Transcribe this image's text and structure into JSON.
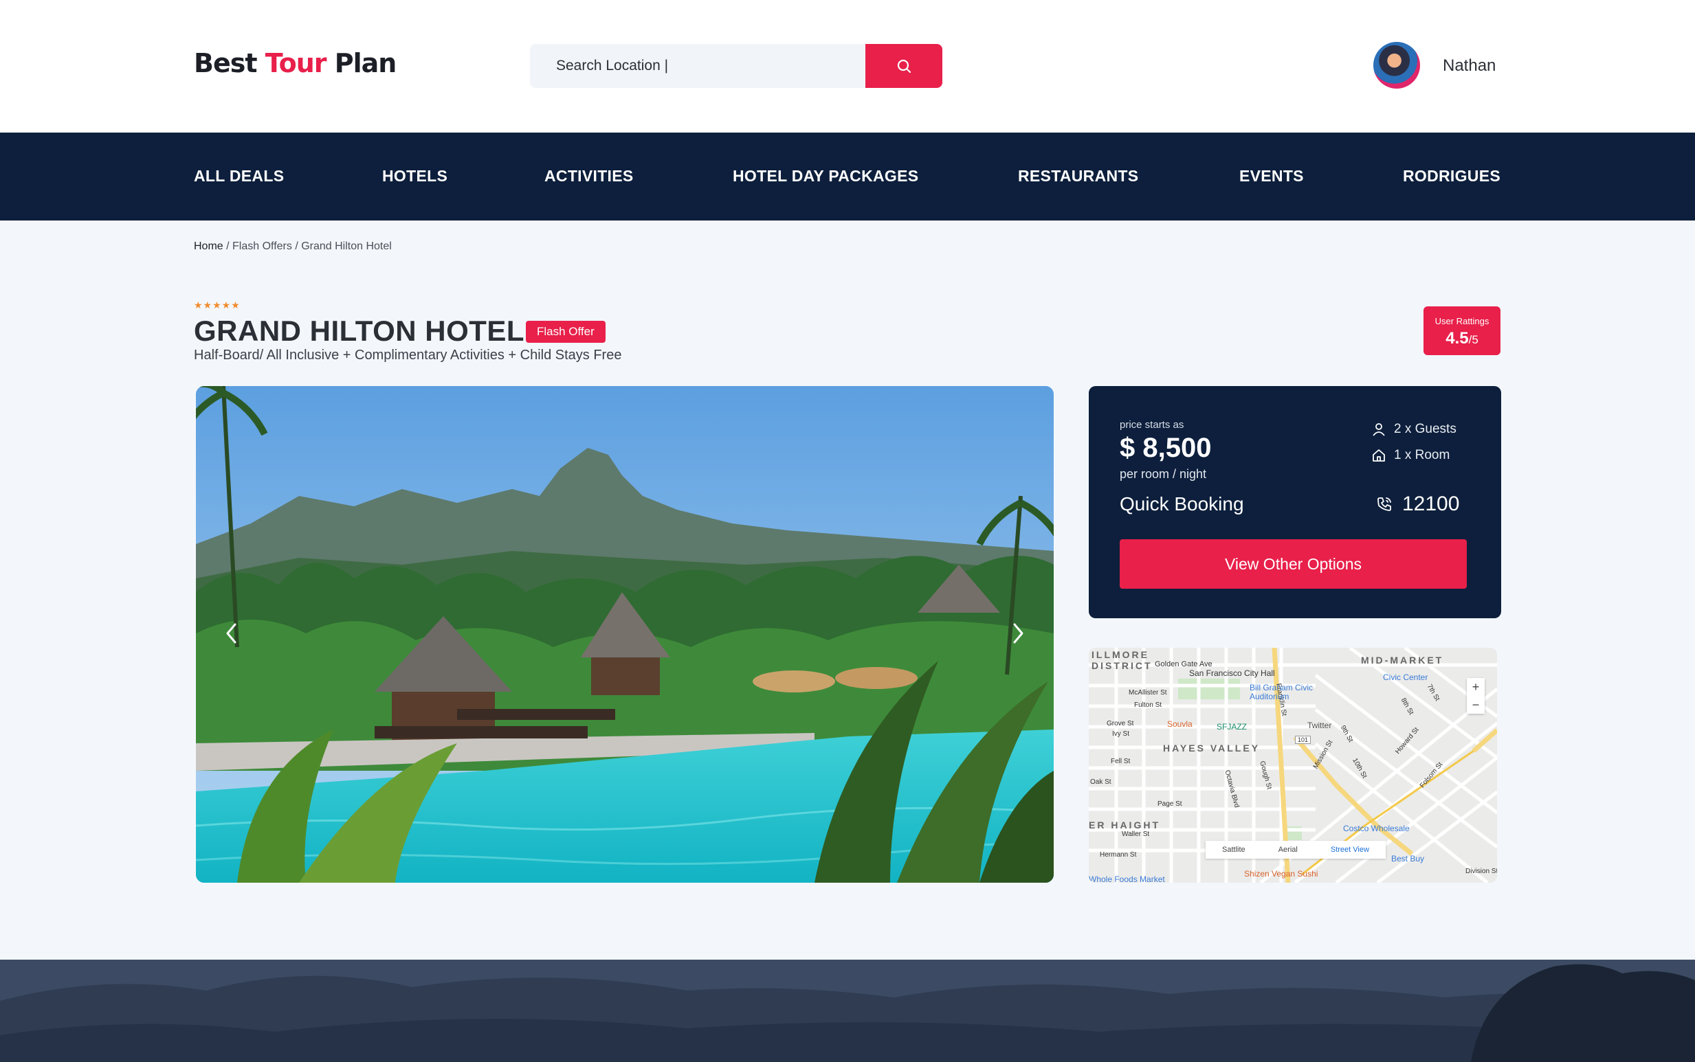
{
  "header": {
    "logo_part1": "Best ",
    "logo_accent": "Tour",
    "logo_part2": " Plan",
    "search_placeholder": "Search Location |",
    "search_icon": "search-icon",
    "user_name": "Nathan"
  },
  "nav": {
    "items": [
      "ALL DEALS",
      "HOTELS",
      "ACTIVITIES",
      "HOTEL DAY PACKAGES",
      "RESTAURANTS",
      "EVENTS",
      "RODRIGUES"
    ]
  },
  "breadcrumb": {
    "home": "Home",
    "rest": " / Flash Offers / Grand Hilton Hotel"
  },
  "hotel": {
    "stars": "★★★★★",
    "name": "GRAND HILTON HOTEL",
    "badge": "Flash Offer",
    "subtitle": "Half-Board/ All Inclusive + Complimentary Activities + Child Stays Free"
  },
  "rating": {
    "label": "User Rattings",
    "value": "4.5",
    "max": "/5"
  },
  "booking": {
    "price_label": "price starts as",
    "price": "$ 8,500",
    "per": "per room / night",
    "guests": "2 x Guests",
    "rooms": "1 x Room",
    "quick_booking": "Quick Booking",
    "phone": "12100",
    "cta": "View Other Options"
  },
  "map": {
    "areas": [
      "ILLMORE",
      "DISTRICT",
      "MID-MARKET",
      "HAYES VALLEY",
      "ER HAIGHT"
    ],
    "streets": [
      "Golden Gate Ave",
      "McAllister St",
      "Fulton St",
      "Grove St",
      "Ivy St",
      "Fell St",
      "Oak St",
      "Page St",
      "Waller St",
      "Hermann St",
      "Octavia Blvd",
      "Gough St",
      "Franklin St",
      "Mission St",
      "Howard St",
      "Folsom St",
      "8th St",
      "9th St",
      "10th St",
      "7th St",
      "Division St"
    ],
    "pois": [
      "San Francisco City Hall",
      "Bill Graham Civic Auditorium",
      "Civic Center",
      "Souvla",
      "SFJAZZ",
      "Twitter",
      "Costco Wholesale",
      "Best Buy",
      "Shizen Vegan Sushi",
      "Whole Foods Market"
    ],
    "highway": "101",
    "views": [
      "Sattlite",
      "Aerial",
      "Street View"
    ],
    "active_view": "Street View"
  },
  "colors": {
    "brand": "#e8204a",
    "navy": "#0d1f3c",
    "page_bg": "#f3f7fb",
    "stars": "#f08c2e"
  }
}
